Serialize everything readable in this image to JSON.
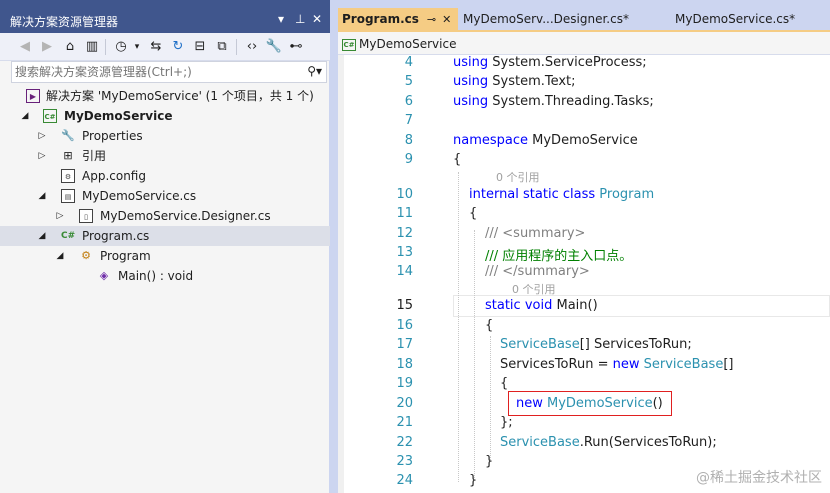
{
  "solution_explorer": {
    "title": "解决方案资源管理器",
    "search_placeholder": "搜索解决方案资源管理器(Ctrl+;)",
    "tree": {
      "solution": "解决方案 'MyDemoService' (1 个项目，共 1 个)",
      "project": "MyDemoService",
      "properties": "Properties",
      "references": "引用",
      "app_config": "App.config",
      "service_cs": "MyDemoService.cs",
      "service_designer_cs": "MyDemoService.Designer.cs",
      "program_cs": "Program.cs",
      "program_class": "Program",
      "main_method": "Main() : void"
    }
  },
  "editor": {
    "tabs": [
      {
        "label": "Program.cs",
        "active": true
      },
      {
        "label": "MyDemoServ...Designer.cs*",
        "active": false
      },
      {
        "label": "MyDemoService.cs*",
        "active": false
      }
    ],
    "nav_member": "MyDemoService",
    "code_lens": [
      "0 个引用",
      "0 个引用"
    ],
    "line_numbers": [
      "4",
      "5",
      "6",
      "7",
      "8",
      "9",
      "10",
      "11",
      "12",
      "13",
      "14",
      "15",
      "16",
      "17",
      "18",
      "19",
      "20",
      "21",
      "22",
      "23",
      "24"
    ],
    "current_line": "15",
    "lines": {
      "l4": "using System.ServiceProcess;",
      "l5": "using System.Text;",
      "l6": "using System.Threading.Tasks;",
      "l8": "namespace MyDemoService",
      "l9": "{",
      "l10": "internal static class Program",
      "l11": "{",
      "l12": "/// <summary>",
      "l13": "/// 应用程序的主入口点。",
      "l14": "/// </summary>",
      "l15": "static void Main()",
      "l16": "{",
      "l17": "ServiceBase[] ServicesToRun;",
      "l18": "ServicesToRun = new ServiceBase[]",
      "l19": "{",
      "l20": "new MyDemoService()",
      "l21": "};",
      "l22": "ServiceBase.Run(ServicesToRun);",
      "l23": "}",
      "l24": "}"
    }
  },
  "watermark": "@稀土掘金技术社区",
  "colors": {
    "title_bar": "#40568d",
    "active_tab": "#f5cc84",
    "keyword": "#0000ff",
    "type": "#2b91af",
    "comment": "#008000",
    "highlight_box": "#e02020"
  }
}
